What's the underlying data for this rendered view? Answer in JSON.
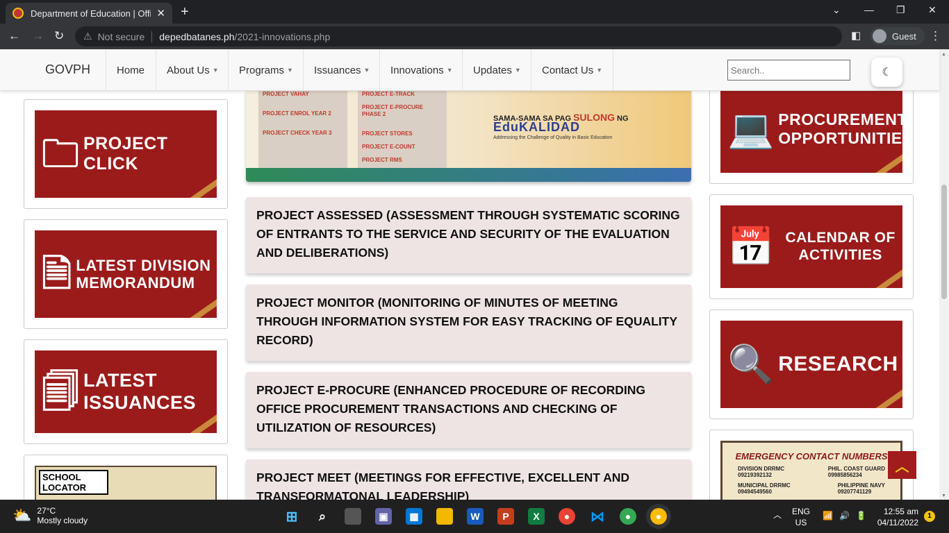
{
  "browser": {
    "tab_title": "Department of Education | Official",
    "new_tab": "+",
    "url_warning": "Not secure",
    "url_host": "depedbatanes.ph",
    "url_path": "/2021-innovations.php",
    "profile": "Guest"
  },
  "navbar": {
    "brand": "GOVPH",
    "items": [
      "Home",
      "About Us",
      "Programs",
      "Issuances",
      "Innovations",
      "Updates",
      "Contact Us"
    ],
    "search_placeholder": "Search.."
  },
  "left_banners": [
    "Project Click",
    "Latest Division Memorandum",
    "Latest Issuances"
  ],
  "school_locator": "SCHOOL LOCATOR",
  "hero": {
    "col1": [
      "PROJECT VAHAY",
      "PROJECT ENROL YEAR 2",
      "PROJECT CHECK YEAR 3"
    ],
    "col2": [
      "PROJECT E-TRACK",
      "PROJECT E-PROCURE PHASE 2",
      "PROJECT STORES",
      "PROJECT E-COUNT",
      "PROJECT RMS"
    ],
    "slogan_a": "SAMA-SAMA SA PAG ",
    "slogan_b": "SULONG",
    "slogan_c": " NG",
    "edu": "EduKALIDAD",
    "sub": "Addressing the Challenge of Quality in Basic Education"
  },
  "projects": [
    "PROJECT ASSESSED (ASSESSMENT THROUGH SYSTEMATIC SCORING OF ENTRANTS TO THE SERVICE AND SECURITY OF THE EVALUATION AND DELIBERATIONS)",
    "PROJECT MONITOR (MONITORING OF MINUTES OF MEETING THROUGH INFORMATION SYSTEM FOR EASY TRACKING OF EQUALITY RECORD)",
    "PROJECT E-PROCURE (ENHANCED PROCEDURE OF RECORDING OFFICE PROCUREMENT TRANSACTIONS AND CHECKING OF UTILIZATION OF RESOURCES)",
    "PROJECT MEET (MEETINGS FOR EFFECTIVE, EXCELLENT AND TRANSFORMATONAL LEADERSHIP)"
  ],
  "right_banners": [
    "Procurement Opportunities",
    "Calendar of Activities",
    "Research"
  ],
  "emergency": {
    "title": "EMERGENCY CONTACT NUMBERS",
    "entries": [
      {
        "name": "DIVISION DRRMC",
        "number": "09219392132"
      },
      {
        "name": "PHIL. COAST GUARD",
        "number": "09985856234"
      },
      {
        "name": "MUNICIPAL DRRMC",
        "number": "09494549560"
      },
      {
        "name": "PHILIPPINE NAVY",
        "number": "09207741129"
      }
    ]
  },
  "taskbar": {
    "temp": "27°C",
    "weather": "Mostly cloudy",
    "lang": "ENG",
    "region": "US",
    "time": "12:55 am",
    "date": "04/11/2022",
    "notifications": "1"
  }
}
